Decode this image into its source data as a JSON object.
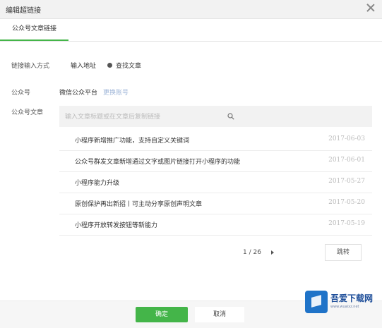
{
  "dialog": {
    "title": "编辑超链接"
  },
  "tabs": [
    {
      "label": "公众号文章链接"
    }
  ],
  "form": {
    "method_label": "链接输入方式",
    "method_options": [
      {
        "label": "输入地址"
      },
      {
        "label": "查找文章"
      }
    ],
    "method_selected": "查找文章",
    "account_label": "公众号",
    "account_name": "微信公众平台",
    "account_change": "更换账号",
    "article_label": "公众号文章"
  },
  "search": {
    "placeholder": "输入文章标题或在文章后复制链接"
  },
  "articles": [
    {
      "title": "小程序新增推广功能，支持自定义关键词",
      "date": "2017-06-03"
    },
    {
      "title": "公众号群发文章新增通过文字或图片链接打开小程序的功能",
      "date": "2017-06-01"
    },
    {
      "title": "小程序能力升级",
      "date": "2017-05-27"
    },
    {
      "title": "原创保护再出新招丨可主动分享原创声明文章",
      "date": "2017-05-20"
    },
    {
      "title": "小程序开放转发按钮等新能力",
      "date": "2017-05-19"
    }
  ],
  "pagination": {
    "text": "1 / 26",
    "jump_label": "跳转"
  },
  "footer": {
    "confirm_label": "确定",
    "cancel_label": "取消"
  },
  "watermark": {
    "text": "吾爱下载网",
    "url": "www.wuaixz.net"
  },
  "colors": {
    "accent": "#44b549",
    "link": "#9fb6d8"
  }
}
